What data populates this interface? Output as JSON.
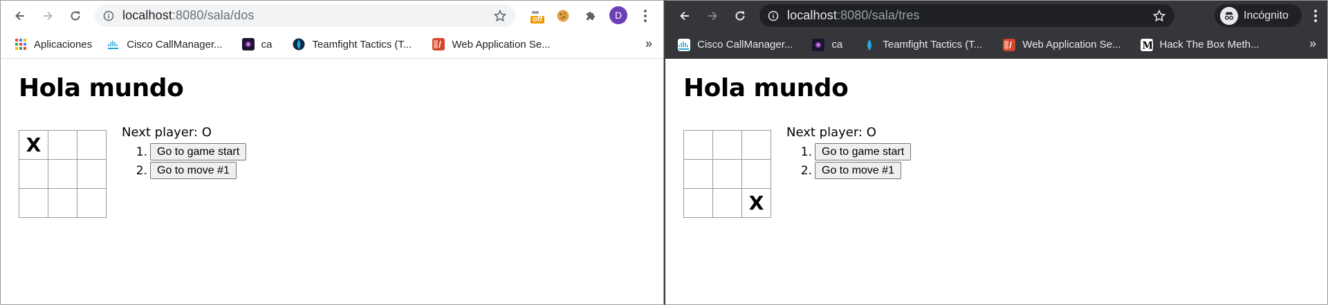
{
  "windows": [
    {
      "theme": "light",
      "url": {
        "host": "localhost",
        "path": ":8080/sala/dos"
      },
      "extensions": {
        "off_badge": "off",
        "profile_initial": "D"
      },
      "bookmarks": [
        {
          "label": "Aplicaciones",
          "icon": "apps-grid-icon"
        },
        {
          "label": "Cisco CallManager...",
          "icon": "cisco-icon"
        },
        {
          "label": "ca",
          "icon": "ca-icon"
        },
        {
          "label": "Teamfight Tactics (T...",
          "icon": "teamfight-icon"
        },
        {
          "label": "Web Application Se...",
          "icon": "webapp-icon"
        }
      ],
      "more": "»",
      "page": {
        "title": "Hola mundo",
        "status": "Next player: O",
        "board": [
          "X",
          "",
          "",
          "",
          "",
          "",
          "",
          "",
          ""
        ],
        "moves": [
          {
            "num": "1.",
            "label": "Go to game start"
          },
          {
            "num": "2.",
            "label": "Go to move #1"
          }
        ]
      }
    },
    {
      "theme": "dark",
      "url": {
        "host": "localhost",
        "path": ":8080/sala/tres"
      },
      "incognito_label": "Incógnito",
      "bookmarks": [
        {
          "label": "Cisco CallManager...",
          "icon": "cisco-icon"
        },
        {
          "label": "ca",
          "icon": "ca-icon"
        },
        {
          "label": "Teamfight Tactics (T...",
          "icon": "teamfight-icon"
        },
        {
          "label": "Web Application Se...",
          "icon": "webapp-icon"
        },
        {
          "label": "Hack The Box Meth...",
          "icon": "medium-icon"
        }
      ],
      "more": "»",
      "page": {
        "title": "Hola mundo",
        "status": "Next player: O",
        "board": [
          "",
          "",
          "",
          "",
          "",
          "",
          "",
          "",
          "X"
        ],
        "moves": [
          {
            "num": "1.",
            "label": "Go to game start"
          },
          {
            "num": "2.",
            "label": "Go to move #1"
          }
        ]
      }
    }
  ]
}
